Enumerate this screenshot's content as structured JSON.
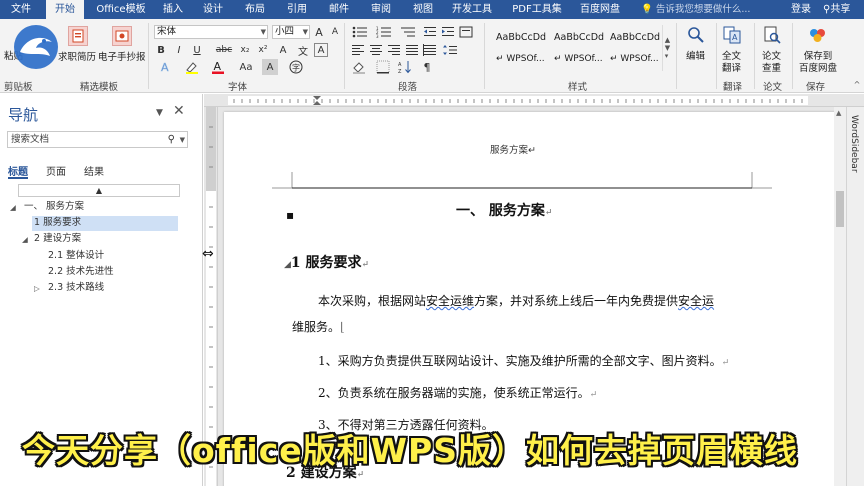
{
  "tabs": [
    {
      "label": "文件",
      "active": false
    },
    {
      "label": "开始",
      "active": true
    },
    {
      "label": "Office模板",
      "active": false
    },
    {
      "label": "插入",
      "active": false
    },
    {
      "label": "设计",
      "active": false
    },
    {
      "label": "布局",
      "active": false
    },
    {
      "label": "引用",
      "active": false
    },
    {
      "label": "邮件",
      "active": false
    },
    {
      "label": "审阅",
      "active": false
    },
    {
      "label": "视图",
      "active": false
    },
    {
      "label": "开发工具",
      "active": false
    },
    {
      "label": "PDF工具集",
      "active": false
    },
    {
      "label": "百度网盘",
      "active": false
    }
  ],
  "tell_me": "告诉我您想要做什么...",
  "login": "登录",
  "share": "共享",
  "ribbon": {
    "clipboard": {
      "paste": "粘贴",
      "group": "剪贴板"
    },
    "templates": {
      "resume": "求职简历",
      "notebook": "电子手抄报",
      "group": "精选模板"
    },
    "font": {
      "name": "宋体",
      "size": "小四",
      "group": "字体",
      "bold": "B",
      "italic": "I",
      "underline": "U",
      "strike": "abc",
      "sub": "x₂",
      "sup": "x²",
      "clear": "A",
      "grow": "A",
      "shrink": "A",
      "aa": "Aa",
      "wen": "文",
      "wen2": "A"
    },
    "paragraph": {
      "group": "段落"
    },
    "styles": {
      "group": "样式",
      "items": [
        {
          "sample": "AaBbCcDd",
          "name": "↵ WPSOf..."
        },
        {
          "sample": "AaBbCcDd",
          "name": "↵ WPSOf..."
        },
        {
          "sample": "AaBbCcDd",
          "name": "↵ WPSOf..."
        }
      ]
    },
    "editing": {
      "label": "编辑"
    },
    "translate": {
      "label1": "全文",
      "label2": "翻译",
      "group": "翻译"
    },
    "paper": {
      "label1": "论文",
      "label2": "查重",
      "group": "论文"
    },
    "save": {
      "label1": "保存到",
      "label2": "百度网盘",
      "group": "保存"
    }
  },
  "nav": {
    "title": "导航",
    "search_placeholder": "搜索文档",
    "tabs": [
      "标题",
      "页面",
      "结果"
    ],
    "tree": [
      {
        "label": "一、 服务方案",
        "level": 0,
        "expanded": true,
        "selected": false
      },
      {
        "label": "1 服务要求",
        "level": 1,
        "expanded": null,
        "selected": true
      },
      {
        "label": "2 建设方案",
        "level": 0,
        "expanded": true,
        "selected": false
      },
      {
        "label": "2.1 整体设计",
        "level": 2,
        "expanded": null,
        "selected": false
      },
      {
        "label": "2.2 技术先进性",
        "level": 2,
        "expanded": null,
        "selected": false
      },
      {
        "label": "2.3 技术路线",
        "level": 1,
        "expanded": false,
        "selected": false
      }
    ]
  },
  "document": {
    "header_text": "服务方案↵",
    "heading1": "一、 服务方案",
    "heading2": "1   服务要求",
    "para_main_a": "本次采购，根据网站",
    "para_main_b": "安全运维",
    "para_main_c": "方案，并对系统上线后一年内免费提供",
    "para_main_d": "安全运",
    "para_main_e": "维服务。",
    "item1": "1、采购方负责提供互联网站设计、实施及维护所需的全部文字、图片资料。",
    "item2": "2、负责系统在服务器端的实施，使系统正常运行。",
    "item3": "3、不得对第三方透露任何资料。",
    "heading3": "2   建设方案",
    "pilcrow": "↵"
  },
  "right_sidebar_label": "WordSidebar",
  "caption": "今天分享（office版和WPS版）如何去掉页眉横线",
  "colors": {
    "accent": "#2b579a",
    "caption": "#fff04a",
    "nav_selected": "#cfe0f5"
  }
}
